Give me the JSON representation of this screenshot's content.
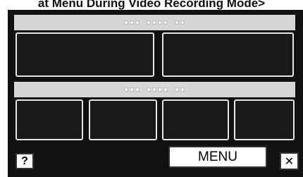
{
  "caption": "at Menu During Video Recording Mode>",
  "top_section": {
    "buttons": [
      "",
      ""
    ]
  },
  "bottom_section": {
    "buttons": [
      "",
      "",
      "",
      ""
    ]
  },
  "footer": {
    "help_label": "?",
    "menu_label": "MENU",
    "close_label": "✕"
  }
}
